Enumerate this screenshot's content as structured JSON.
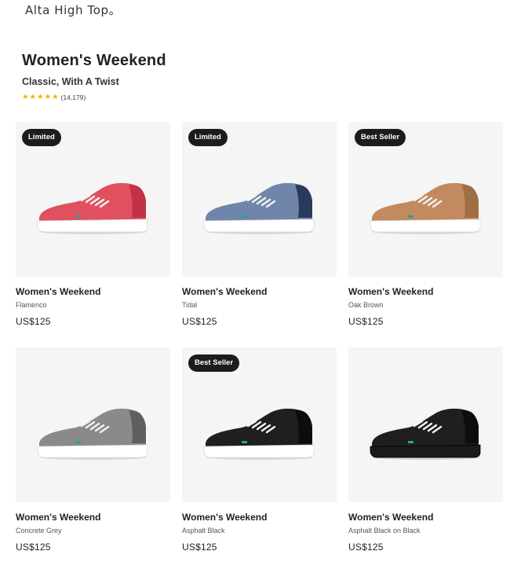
{
  "top_note": "Alta High Top。",
  "collection": {
    "title": "Women's Weekend",
    "subtitle": "Classic, With A Twist",
    "rating_stars": 5,
    "review_count": "(14,179)"
  },
  "products": [
    {
      "name": "Women's Weekend",
      "color": "Flamenco",
      "price": "US$125",
      "badge": "Limited",
      "upper": "#e0505f",
      "dark": "#c23145",
      "sole": "#ffffff"
    },
    {
      "name": "Women's Weekend",
      "color": "Tidal",
      "price": "US$125",
      "badge": "Limited",
      "upper": "#6f86aa",
      "dark": "#2a3a5c",
      "sole": "#ffffff"
    },
    {
      "name": "Women's Weekend",
      "color": "Oak Brown",
      "price": "US$125",
      "badge": "Best Seller",
      "upper": "#c28a5e",
      "dark": "#a06e45",
      "sole": "#ffffff"
    },
    {
      "name": "Women's Weekend",
      "color": "Concrete Grey",
      "price": "US$125",
      "badge": "",
      "upper": "#8a8a8a",
      "dark": "#5f5f5f",
      "sole": "#ffffff"
    },
    {
      "name": "Women's Weekend",
      "color": "Asphalt Black",
      "price": "US$125",
      "badge": "Best Seller",
      "upper": "#1f1f1f",
      "dark": "#0d0d0d",
      "sole": "#ffffff"
    },
    {
      "name": "Women's Weekend",
      "color": "Asphalt Black on Black",
      "price": "US$125",
      "badge": "",
      "upper": "#1f1f1f",
      "dark": "#0d0d0d",
      "sole": "#1a1a1a"
    }
  ]
}
